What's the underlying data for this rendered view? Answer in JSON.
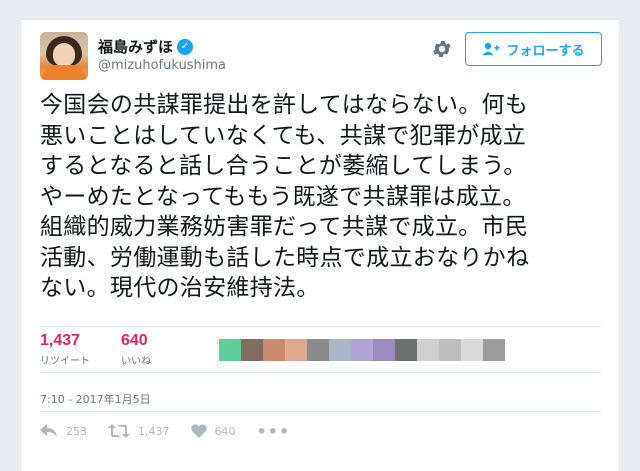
{
  "user": {
    "display_name": "福島みずほ",
    "handle": "@mizuhofukushima",
    "verified_glyph": "✓",
    "avatar_icon": "user-avatar-photo"
  },
  "follow_button": {
    "label": "フォローする",
    "icon": "add-user-icon"
  },
  "settings_icon": "gear-icon",
  "tweet": {
    "text": "今国会の共謀罪提出を許してはならない。何も\n悪いことはしていなくても、共謀で犯罪が成立\nするとなると話し合うことが萎縮してしまう。\nやーめたとなってももう既遂で共謀罪は成立。\n組織的威力業務妨害罪だって共謀で成立。市民\n活動、労働運動も話した時点で成立おなりかね\nない。現代の治安維持法。"
  },
  "stats": {
    "retweets": {
      "count": "1,437",
      "label": "リツイート"
    },
    "likes": {
      "count": "640",
      "label": "いいね"
    }
  },
  "liker_avatars": [
    "#5fcf9a",
    "#7d6e60",
    "#c98a6e",
    "#e0a98f",
    "#8a8a8a",
    "#a8b6c7",
    "#b1a5d6",
    "#9d8bbf",
    "#6f7070",
    "#cfcfcf",
    "#bdbdbd",
    "#dadada",
    "#9b9b9b"
  ],
  "timestamp": "7:10 - 2017年1月5日",
  "actions": {
    "reply": {
      "icon": "reply-icon",
      "count": "253"
    },
    "retweet": {
      "icon": "retweet-icon",
      "count": "1,437"
    },
    "like": {
      "icon": "heart-icon",
      "count": "640"
    },
    "more": {
      "icon": "more-icon",
      "label": "•••"
    }
  },
  "colors": {
    "accent": "#1da1f2",
    "like": "#e0245e",
    "muted": "#657786",
    "action": "#aab8c2",
    "background": "#e6ecf0"
  }
}
